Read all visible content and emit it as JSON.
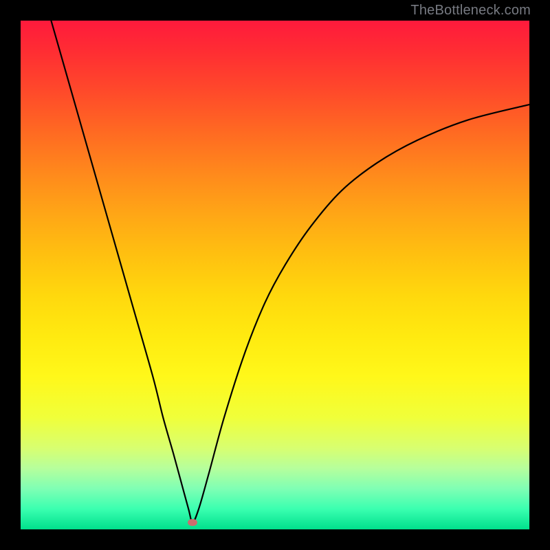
{
  "watermark": "TheBottleneck.com",
  "marker": {
    "x_pct": 33.8,
    "y_pct": 98.6
  },
  "chart_data": {
    "type": "line",
    "title": "",
    "xlabel": "",
    "ylabel": "",
    "xlim": [
      0,
      100
    ],
    "ylim": [
      0,
      100
    ],
    "grid": false,
    "legend": false,
    "series": [
      {
        "name": "bottleneck-curve",
        "x": [
          6.0,
          10.0,
          14.0,
          18.0,
          22.0,
          26.0,
          28.0,
          30.0,
          31.5,
          33.0,
          33.8,
          35.0,
          37.0,
          40.0,
          44.0,
          48.0,
          52.0,
          57.0,
          63.0,
          70.0,
          78.0,
          88.0,
          100.0
        ],
        "y": [
          100.0,
          86.0,
          72.0,
          58.0,
          44.0,
          30.0,
          22.0,
          15.0,
          9.5,
          4.0,
          1.4,
          4.0,
          11.0,
          22.0,
          34.5,
          44.5,
          52.0,
          59.5,
          66.5,
          72.0,
          76.5,
          80.5,
          83.5
        ]
      }
    ],
    "annotations": [
      {
        "type": "marker",
        "x": 33.8,
        "y": 1.4,
        "label": "optimal-point"
      }
    ],
    "background_gradient": {
      "direction": "vertical",
      "stops": [
        {
          "pos": 0.0,
          "color": "#ff1a3c"
        },
        {
          "pos": 0.5,
          "color": "#ffd80d"
        },
        {
          "pos": 0.8,
          "color": "#f0ff3a"
        },
        {
          "pos": 1.0,
          "color": "#00e08c"
        }
      ]
    }
  }
}
